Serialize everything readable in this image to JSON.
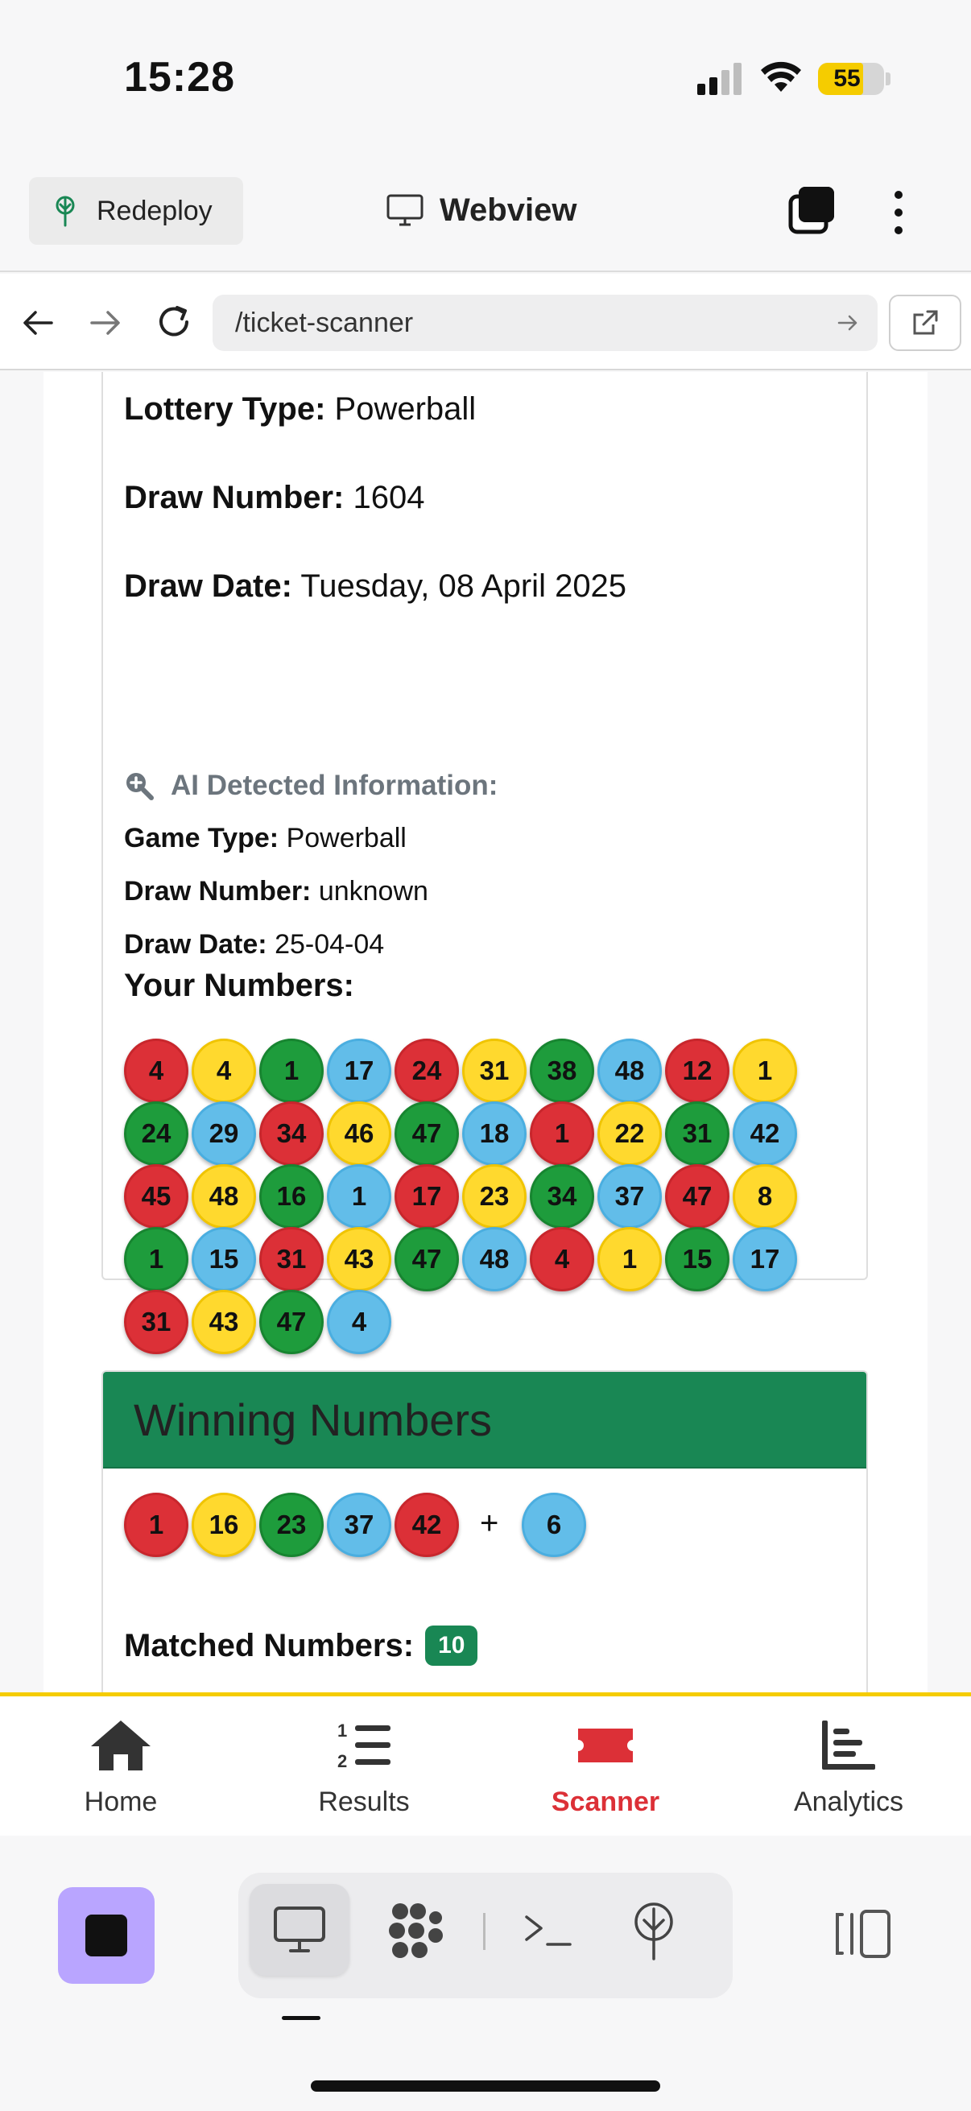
{
  "status_bar": {
    "time": "15:28",
    "battery": "55"
  },
  "header": {
    "redeploy_label": "Redeploy",
    "title": "Webview"
  },
  "url_bar": {
    "url": "/ticket-scanner"
  },
  "ticket": {
    "lottery_type_label": "Lottery Type:",
    "lottery_type": "Powerball",
    "draw_number_label": "Draw Number:",
    "draw_number": "1604",
    "draw_date_label": "Draw Date:",
    "draw_date": "Tuesday, 08 April 2025",
    "ai_heading": "AI Detected Information:",
    "ai_game_type_label": "Game Type:",
    "ai_game_type": "Powerball",
    "ai_draw_number_label": "Draw Number:",
    "ai_draw_number": "unknown",
    "ai_draw_date_label": "Draw Date:",
    "ai_draw_date": "25-04-04",
    "your_numbers_label": "Your Numbers:",
    "numbers": [
      4,
      4,
      1,
      17,
      24,
      31,
      38,
      48,
      12,
      1,
      24,
      29,
      34,
      46,
      47,
      18,
      1,
      22,
      31,
      42,
      45,
      48,
      16,
      1,
      17,
      23,
      34,
      37,
      47,
      8,
      1,
      15,
      31,
      43,
      47,
      48,
      4,
      1,
      15,
      17,
      31,
      43,
      47,
      4
    ],
    "ball_colors": [
      "red",
      "yellow",
      "green",
      "blue"
    ]
  },
  "winning": {
    "title": "Winning Numbers",
    "numbers": [
      1,
      16,
      23,
      37,
      42
    ],
    "plus": "+",
    "bonus": 6,
    "matched_label": "Matched Numbers:",
    "matched_count": "10"
  },
  "bottom_nav": {
    "items": [
      {
        "label": "Home",
        "icon": "home-icon",
        "active": false
      },
      {
        "label": "Results",
        "icon": "numbered-list-icon",
        "active": false
      },
      {
        "label": "Scanner",
        "icon": "ticket-icon",
        "active": true
      },
      {
        "label": "Analytics",
        "icon": "bar-chart-icon",
        "active": false
      }
    ]
  },
  "colors": {
    "accent_red": "#dc3037",
    "accent_yellow": "#f5cc00",
    "winning_header": "#198754",
    "ball_red": "#dc3037",
    "ball_yellow": "#ffd92e",
    "ball_green": "#1e9c3c",
    "ball_blue": "#62bde9",
    "stop_button": "#b9a5ff"
  }
}
